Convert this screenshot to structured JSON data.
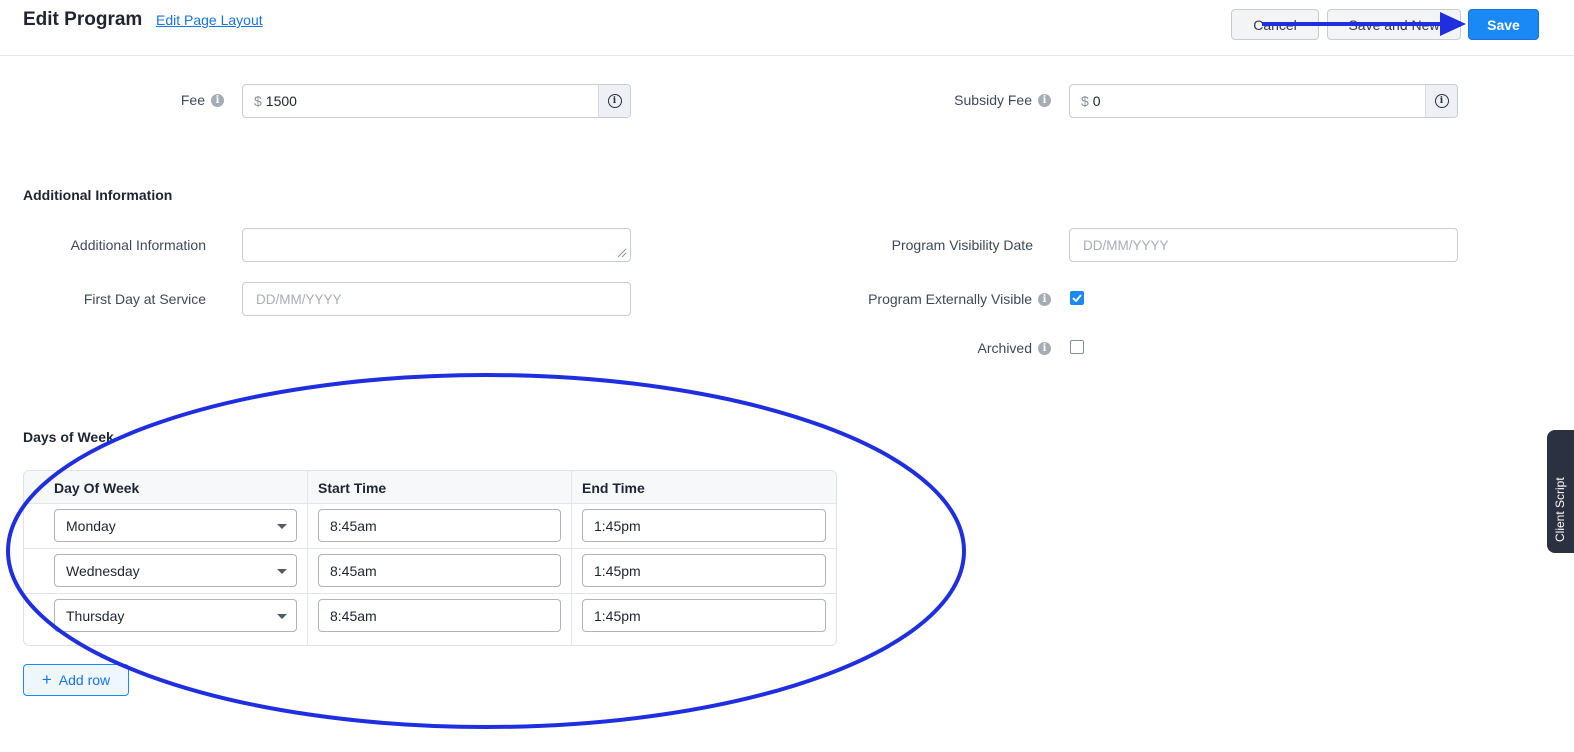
{
  "header": {
    "title": "Edit Program",
    "edit_layout_link": "Edit Page Layout",
    "cancel_label": "Cancel",
    "save_and_new_label": "Save and New",
    "save_label": "Save"
  },
  "fees": {
    "fee_label": "Fee",
    "fee_prefix": "$",
    "fee_value": "1500",
    "subsidy_label": "Subsidy Fee",
    "subsidy_prefix": "$",
    "subsidy_value": "0"
  },
  "additional": {
    "section_title": "Additional Information",
    "additional_info_label": "Additional Information",
    "additional_info_value": "",
    "first_day_label": "First Day at Service",
    "first_day_placeholder": "DD/MM/YYYY",
    "visibility_date_label": "Program Visibility Date",
    "visibility_date_placeholder": "DD/MM/YYYY",
    "externally_visible_label": "Program Externally Visible",
    "externally_visible_checked": true,
    "archived_label": "Archived",
    "archived_checked": false
  },
  "days_of_week": {
    "section_title": "Days of Week",
    "columns": [
      "Day Of Week",
      "Start Time",
      "End Time"
    ],
    "rows": [
      {
        "day": "Monday",
        "start": "8:45am",
        "end": "1:45pm"
      },
      {
        "day": "Wednesday",
        "start": "8:45am",
        "end": "1:45pm"
      },
      {
        "day": "Thursday",
        "start": "8:45am",
        "end": "1:45pm"
      }
    ],
    "add_row_label": "Add row"
  },
  "side_tab": {
    "label": "Client Script"
  },
  "colors": {
    "primary": "#1a88f5",
    "annotation": "#1f2fe0"
  },
  "icons": {
    "info": "info-icon",
    "dropdown": "chevron-down-icon",
    "check": "check-icon",
    "plus": "plus-icon"
  }
}
